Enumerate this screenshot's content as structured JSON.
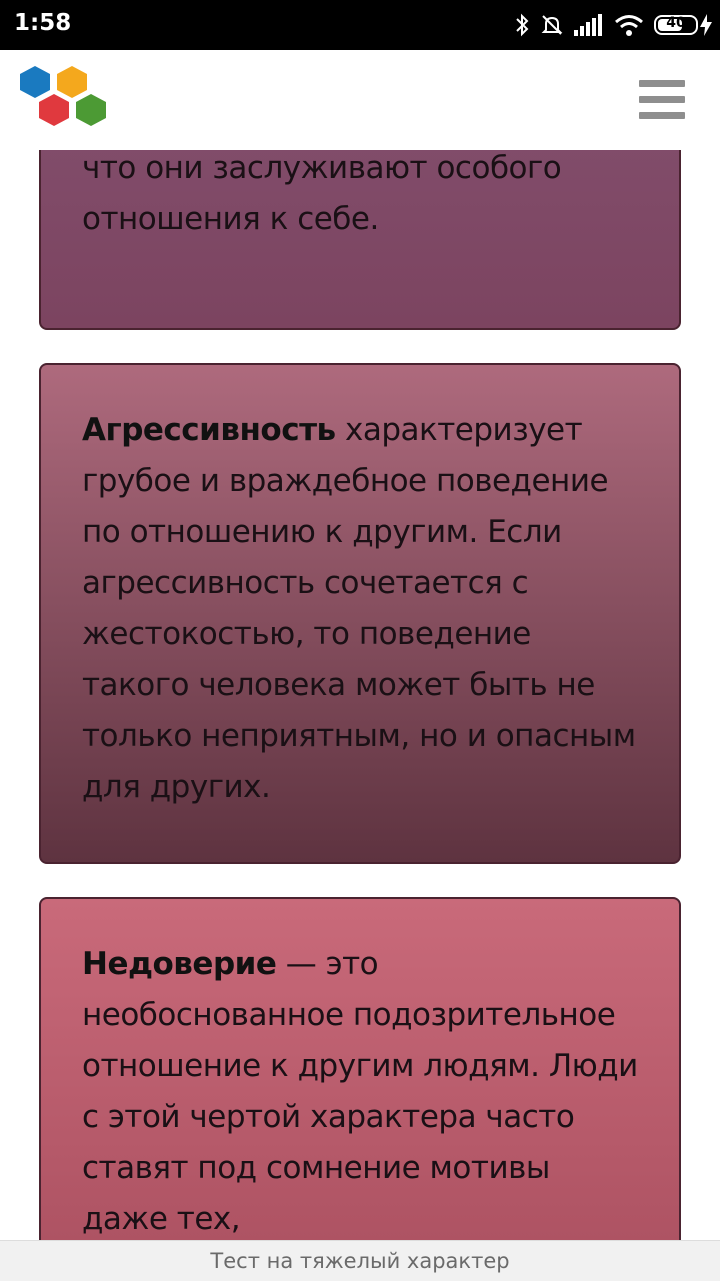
{
  "status_bar": {
    "time": "1:58",
    "battery": "40",
    "icons": [
      "bluetooth-icon",
      "bell-off-icon",
      "signal-icon",
      "wifi-icon",
      "battery-icon",
      "charging-icon"
    ]
  },
  "header": {
    "logo": "hexagon-logo",
    "menu_icon": "hamburger-menu-icon"
  },
  "cards": [
    {
      "bold": "",
      "text": "воображаемую корону и считают, что они заслуживают особого отношения к себе."
    },
    {
      "bold": "Агрессивность",
      "text": " характеризует грубое и враждебное поведение по отношению к другим. Если агрессивность сочетается с жестокостью, то поведение такого человека может быть не только неприятным, но и опасным для других."
    },
    {
      "bold": "Недоверие",
      "text": " — это необоснованное подозрительное отношение к другим людям. Люди с этой чертой характера часто ставят под сомнение мотивы даже тех,"
    }
  ],
  "bottom_bar": {
    "title": "Тест на тяжелый характер"
  },
  "colors": {
    "card1": "#845170",
    "card2_top": "#ae6a7d",
    "card2_bottom": "#5e3340",
    "card3": "#c96a7a",
    "menu": "#8e8e8e"
  }
}
